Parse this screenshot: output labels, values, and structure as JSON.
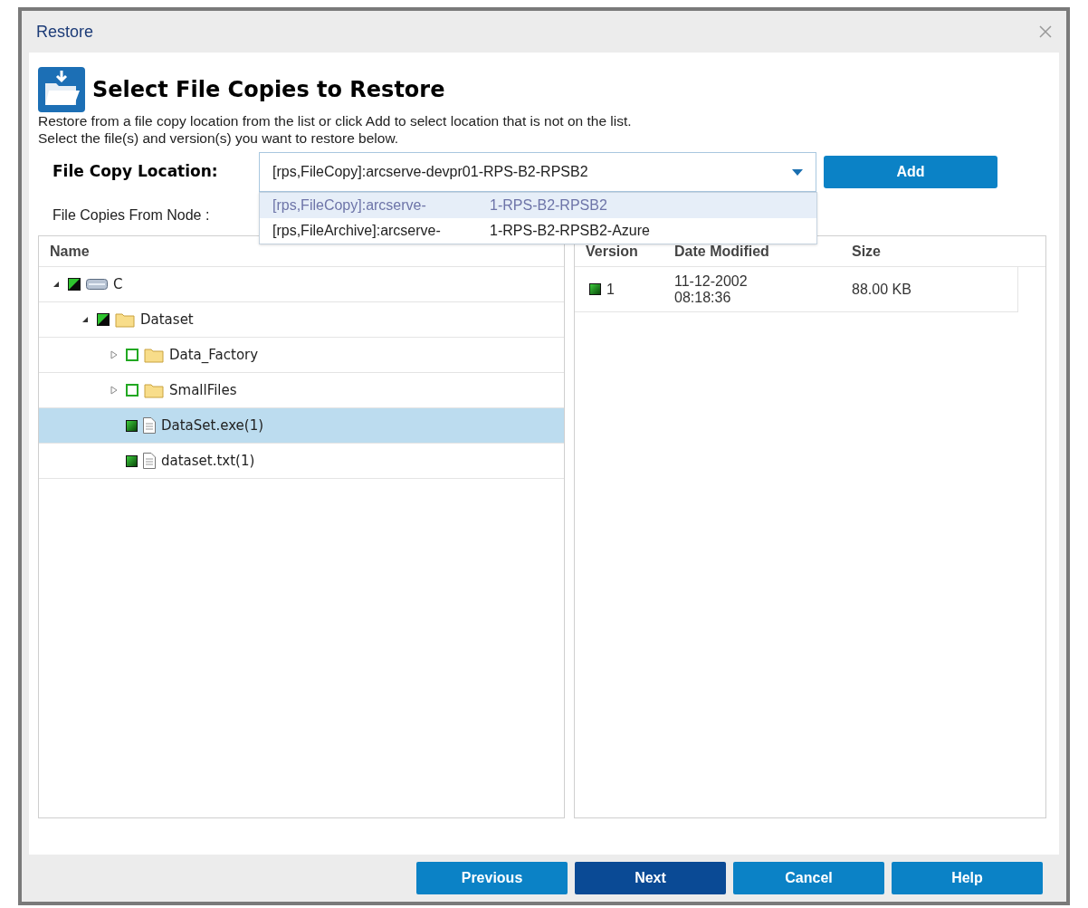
{
  "window": {
    "title": "Restore"
  },
  "header": {
    "title": "Select File Copies to Restore",
    "lines": [
      "Restore from a file copy location from the list or click Add to select location that is not on the list.",
      "Select the file(s) and version(s) you want to restore below."
    ]
  },
  "location": {
    "label": "File Copy Location:",
    "value": "[rps,FileCopy]:arcserve-devpr01-RPS-B2-RPSB2",
    "add_button": "Add",
    "options": [
      {
        "prefix": "[rps,FileCopy]:arcserve-",
        "suffix": "1-RPS-B2-RPSB2",
        "selected": true
      },
      {
        "prefix": "[rps,FileArchive]:arcserve-",
        "suffix": "1-RPS-B2-RPSB2-Azure",
        "selected": false
      }
    ]
  },
  "node_label": "File Copies From Node :",
  "tree": {
    "column": "Name",
    "items": [
      {
        "label": "C",
        "kind": "drive",
        "checked": false,
        "partial": true,
        "expanded": true,
        "selected": false,
        "children": [
          {
            "label": "Dataset",
            "kind": "folder",
            "checked": false,
            "partial": true,
            "expanded": true,
            "selected": false,
            "children": [
              {
                "label": "Data_Factory",
                "kind": "folder",
                "checked": false,
                "partial": false,
                "expanded": false,
                "selected": false
              },
              {
                "label": "SmallFiles",
                "kind": "folder",
                "checked": false,
                "partial": false,
                "expanded": false,
                "selected": false
              },
              {
                "label": "DataSet.exe(1)",
                "kind": "file",
                "checked": true,
                "selected": true
              },
              {
                "label": "dataset.txt(1)",
                "kind": "file",
                "checked": true,
                "selected": false
              }
            ]
          }
        ]
      }
    ]
  },
  "versions": {
    "columns": [
      "Version",
      "Date Modified",
      "Size"
    ],
    "rows": [
      {
        "checked": true,
        "version": "1",
        "date": [
          "11-12-2002",
          "08:18:36"
        ],
        "size": "88.00 KB"
      }
    ]
  },
  "buttons": [
    {
      "label": "Previous",
      "primary": false
    },
    {
      "label": "Next",
      "primary": true
    },
    {
      "label": "Cancel",
      "primary": false
    },
    {
      "label": "Help",
      "primary": false
    }
  ]
}
